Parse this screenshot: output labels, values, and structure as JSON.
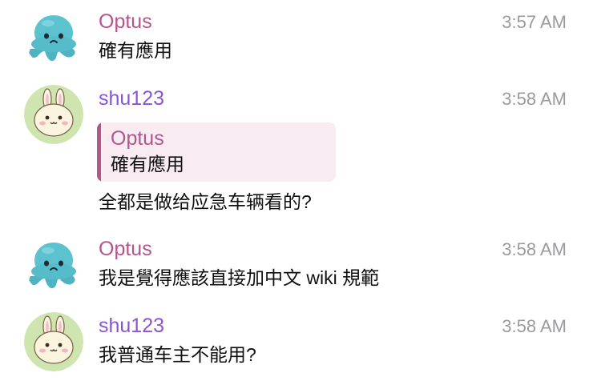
{
  "colors": {
    "optus": "#b4558c",
    "shu123": "#8a54d6",
    "quote_bg": "#f8ebf2",
    "quote_bar": "#b4558c"
  },
  "messages": [
    {
      "sender": "Optus",
      "time": "3:57 AM",
      "avatar_icon": "octopus-plush-icon",
      "text": "確有應用"
    },
    {
      "sender": "shu123",
      "time": "3:58 AM",
      "avatar_icon": "bunny-character-icon",
      "reply": {
        "sender": "Optus",
        "text": "確有應用"
      },
      "text": "全都是做给应急车辆看的?"
    },
    {
      "sender": "Optus",
      "time": "3:58 AM",
      "avatar_icon": "octopus-plush-icon",
      "text": "我是覺得應該直接加中文 wiki 規範"
    },
    {
      "sender": "shu123",
      "time": "3:58 AM",
      "avatar_icon": "bunny-character-icon",
      "text": "我普通车主不能用?"
    }
  ]
}
